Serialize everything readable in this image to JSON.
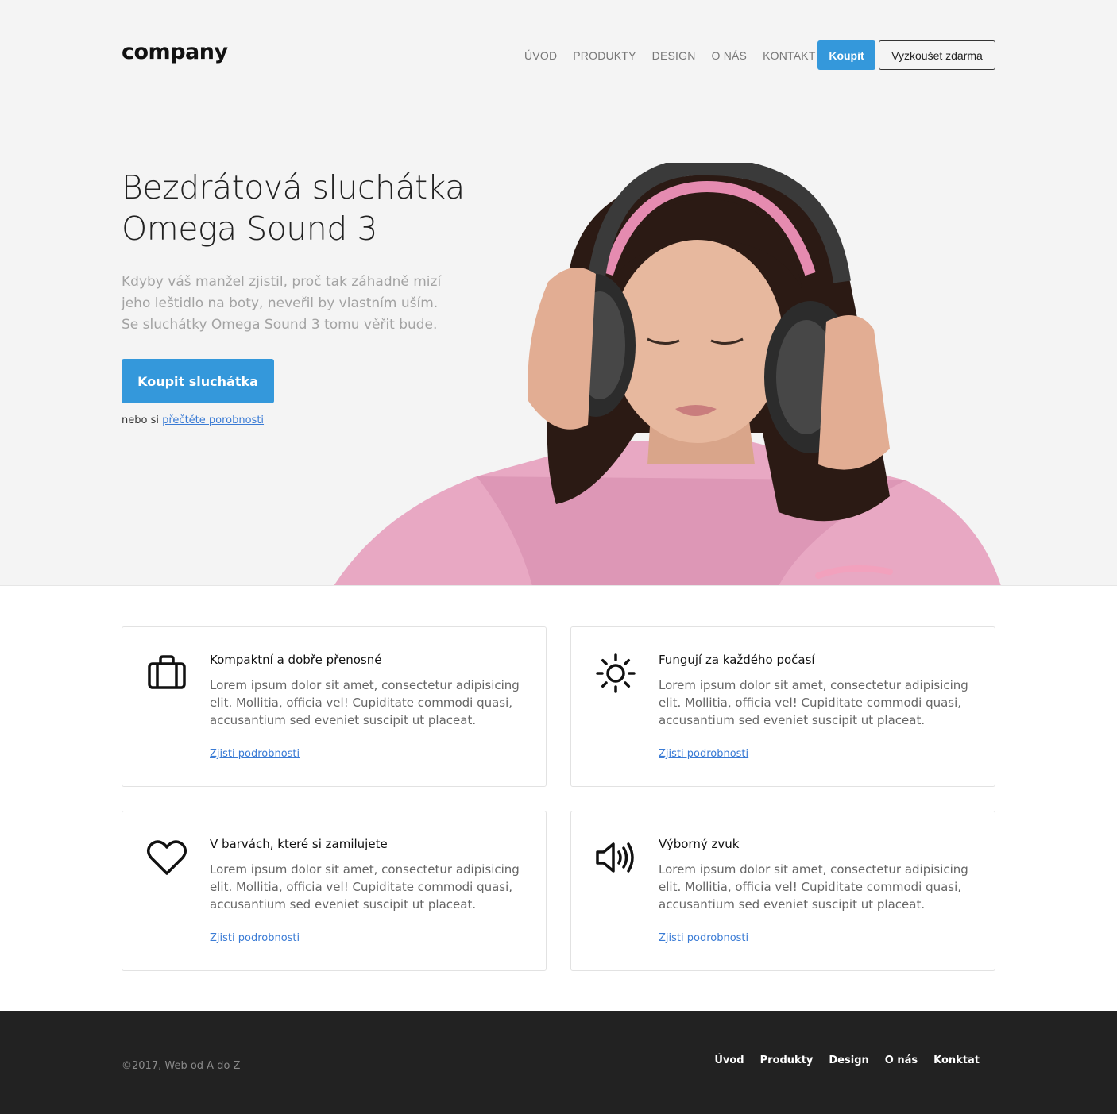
{
  "brand": {
    "logo": "company",
    "accent": "#3498db"
  },
  "nav": {
    "items": [
      "ÚVOD",
      "PRODUKTY",
      "DESIGN",
      "O NÁS",
      "KONTAKT"
    ],
    "buy_label": "Koupit",
    "trial_label": "Vyzkoušet zdarma"
  },
  "hero": {
    "title_line1": "Bezdrátová sluchátka",
    "title_line2": "Omega Sound 3",
    "text": "Kdyby váš manžel zjistil, proč tak záhadně mizí jeho leštidlo na boty, neveřil by vlastním uším. Se sluchátky Omega Sound 3 tomu věřit bude.",
    "cta_label": "Koupit sluchátka",
    "note_prefix": "nebo si",
    "note_link": "přečtěte porobnosti"
  },
  "features": [
    {
      "icon": "briefcase-icon",
      "title": "Kompaktní a dobře přenosné",
      "text": "Lorem ipsum dolor sit amet, consectetur adipisicing elit. Mollitia, officia vel! Cupiditate commodi quasi, accusantium sed eveniet suscipit ut placeat.",
      "link": "Zjisti podrobnosti"
    },
    {
      "icon": "sun-icon",
      "title": "Fungují za každého počasí",
      "text": "Lorem ipsum dolor sit amet, consectetur adipisicing elit. Mollitia, officia vel! Cupiditate commodi quasi, accusantium sed eveniet suscipit ut placeat.",
      "link": "Zjisti podrobnosti"
    },
    {
      "icon": "heart-icon",
      "title": "V barvách, které si zamilujete",
      "text": "Lorem ipsum dolor sit amet, consectetur adipisicing elit. Mollitia, officia vel! Cupiditate commodi quasi, accusantium sed eveniet suscipit ut placeat.",
      "link": "Zjisti podrobnosti"
    },
    {
      "icon": "speaker-icon",
      "title": "Výborný zvuk",
      "text": "Lorem ipsum dolor sit amet, consectetur adipisicing elit. Mollitia, officia vel! Cupiditate commodi quasi, accusantium sed eveniet suscipit ut placeat.",
      "link": "Zjisti podrobnosti"
    }
  ],
  "footer": {
    "copyright": "©2017, Web od A do Z",
    "links": [
      "Úvod",
      "Produkty",
      "Design",
      "O nás",
      "Konktat"
    ]
  }
}
